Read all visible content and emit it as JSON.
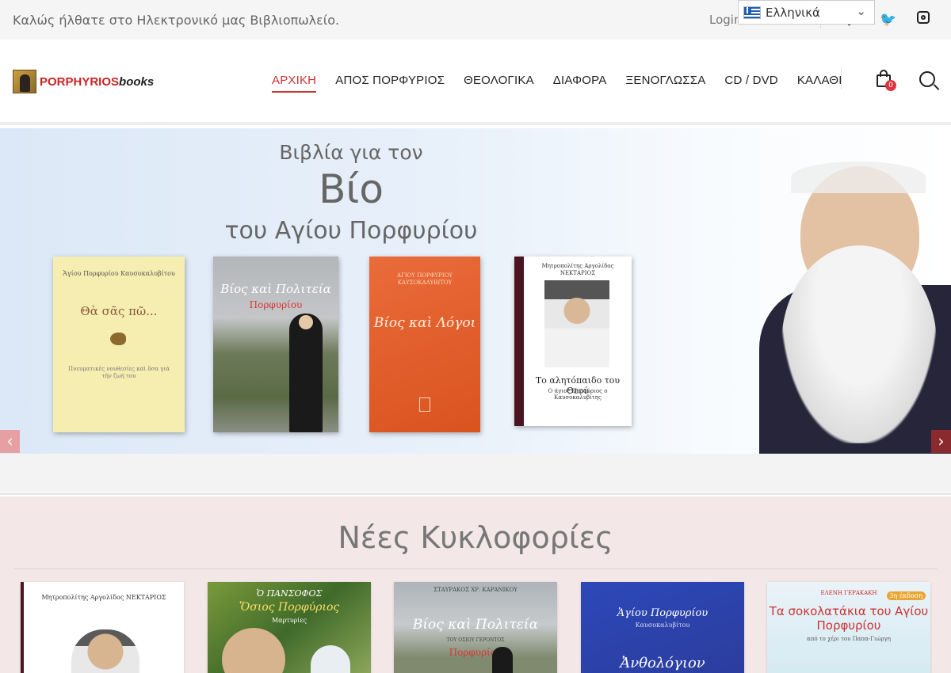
{
  "topbar": {
    "welcome": "Καλώς ήλθατε στο Ηλεκτρονικό μας Βιβλιοπωλείο.",
    "login": "Login",
    "language": "Ελληνικά"
  },
  "logo": {
    "brand_main": "PORPHYRIOS",
    "brand_suffix": "books"
  },
  "nav": {
    "items": [
      "ΑΡΧΙΚΗ",
      "ΑΠΟΣ ΠΟΡΦΥΡΙΟΣ",
      "ΘΕΟΛΟΓΙΚΑ",
      "ΔΙΑΦΟΡΑ",
      "ΞΕΝΟΓΛΩΣΣΑ",
      "CD / DVD",
      "ΚΑΛΑΘΙ"
    ],
    "active": 0
  },
  "cart": {
    "count": "0"
  },
  "banner": {
    "line1": "Βιβλία για τον",
    "line2": "Βίο",
    "line3": "του Αγίου Πορφυρίου",
    "books": [
      {
        "author": "Ἁγίου Πορφυρίου Καυσοκαλυβίτου",
        "title": "Θὰ σᾶς πῶ...",
        "subtitle": "Πνευματικὲς νουθεσίες καὶ ὅσα γιὰ τὴν ζωή του"
      },
      {
        "title": "Βίος καὶ Πολιτεία",
        "subtitle": "Πορφυρίου"
      },
      {
        "author": "ΑΓΙΟΥ ΠΟΡΦΥΡΙΟΥ ΚΑΥΣΟΚΑΛΥΒΙΤΟΥ",
        "title": "Βίος καὶ Λόγοι"
      },
      {
        "author": "Μητροπολίτης Αργολίδος ΝΕΚΤΑΡΙΟΣ",
        "title": "Το αλητόπαιδο του Θεού",
        "subtitle": "Ο άγιος Πορφύριος ο Καυσοκαλυβίτης"
      }
    ]
  },
  "arrows": {
    "prev": "‹",
    "next": "›"
  },
  "releases": {
    "title": "Νέες Κυκλοφορίες",
    "items": [
      {
        "line1": "Μητροπολίτης Αργολίδος ΝΕΚΤΑΡΙΟΣ"
      },
      {
        "line1": "Ὁ ΠΑΝΣΟΦΟΣ",
        "line2": "Ὅσιος Πορφύριος",
        "line3": "Μαρτυρίες"
      },
      {
        "line1": "ΣΤΑΥΡΑΚΟΣ ΧΡ. ΚΑΡΑΝΙΚΟΥ",
        "line2": "Βίος καὶ Πολιτεία",
        "line3": "Πορφυρίου",
        "line4": "ΤΟΥ ΟΣΙΟΥ ΓΕΡΟΝΤΟΣ"
      },
      {
        "line1": "Ἁγίου Πορφυρίου",
        "line2": "Καυσοκαλυβίτου",
        "line3": "Ἀνθολόγιον"
      },
      {
        "line1": "ΕΛΕΝΗ ΓΕΡΑΚΑΚΗ",
        "badge": "3η έκδοση",
        "line2": "Τα σοκολατάκια του Αγίου Πορφυρίου",
        "line3": "από το χέρι του Παπα-Γιώργη"
      }
    ]
  },
  "colors": {
    "accent": "#cc3333",
    "badge": "#d9363e"
  }
}
